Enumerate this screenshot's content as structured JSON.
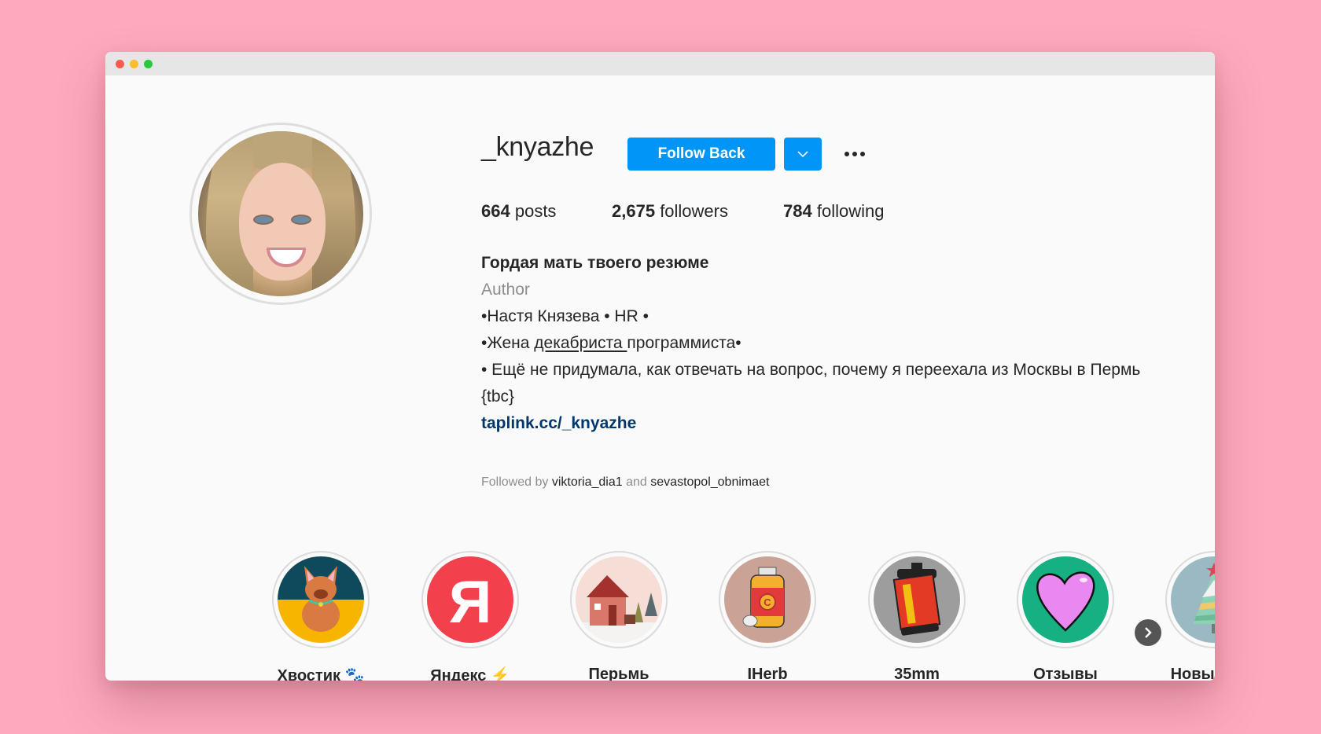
{
  "window": {
    "traffic_lights": [
      "close",
      "minimize",
      "maximize"
    ]
  },
  "profile": {
    "username": "_knyazhe",
    "follow_back_label": "Follow Back",
    "dropdown_icon": "chevron-down-icon",
    "more_icon": "more-options-icon",
    "stats": {
      "posts_count": "664",
      "posts_label": "posts",
      "followers_count": "2,675",
      "followers_label": "followers",
      "following_count": "784",
      "following_label": "following"
    },
    "bio": {
      "name": "Гордая мать твоего резюме",
      "category": "Author",
      "line1": "•Настя Князева • HR •",
      "line2_prefix": "•Жена ",
      "line2_underlined": "декабриста ",
      "line2_suffix": "программиста•",
      "line3": "• Ещё не придумала, как отвечать на вопрос, почему я переехала из Москвы в Пермь {tbc}",
      "link": "taplink.cc/_knyazhe"
    },
    "followed_by": {
      "prefix": "Followed by",
      "user1": "viktoria_dia1",
      "and": "and",
      "user2": "sevastopol_obnimaet"
    }
  },
  "highlights": [
    {
      "label": "Хвостик 🐾",
      "icon": "dog-icon"
    },
    {
      "label": "Яндекс ⚡",
      "icon": "yandex-logo-icon"
    },
    {
      "label": "Перьмь",
      "icon": "house-icon"
    },
    {
      "label": "IHerb",
      "icon": "vitamin-jar-icon"
    },
    {
      "label": "35mm",
      "icon": "film-roll-icon"
    },
    {
      "label": "Отзывы",
      "icon": "heart-icon"
    },
    {
      "label": "Новый го...",
      "icon": "christmas-tree-icon"
    }
  ],
  "highlights_next_icon": "chevron-right-icon",
  "colors": {
    "background": "#fdaabd",
    "accent_blue": "#0095f6",
    "link_blue": "#00376b",
    "secondary_text": "#8e8e8e"
  }
}
